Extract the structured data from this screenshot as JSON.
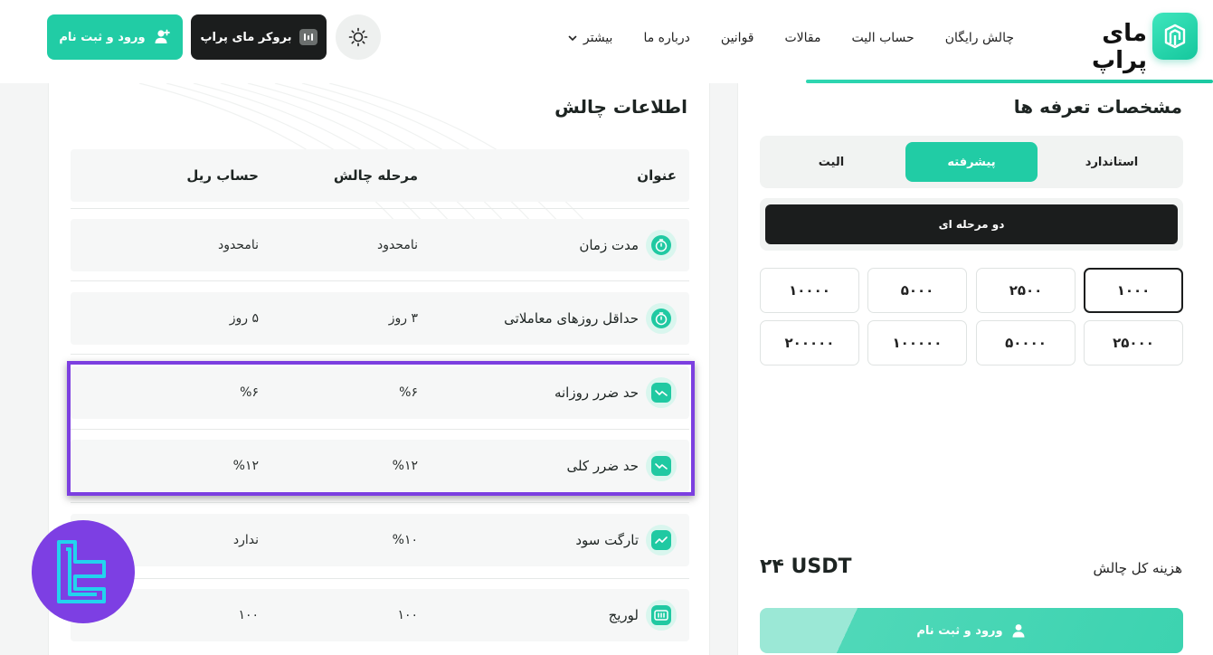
{
  "header": {
    "logo_text": "مای پراپ",
    "nav": [
      {
        "label": "چالش رایگان"
      },
      {
        "label": "حساب الیت"
      },
      {
        "label": "مقالات"
      },
      {
        "label": "قوانین"
      },
      {
        "label": "درباره ما"
      },
      {
        "label": "بیشتر",
        "icon": "chevron-down-icon"
      }
    ],
    "theme_icon": "sun-icon",
    "broker_label": "بروکر مای پراپ",
    "login_label": "ورود و ثبت نام",
    "accent_color": "#21cca5"
  },
  "challenge_info": {
    "title": "اطلاعات چالش",
    "headers": {
      "title": "عنوان",
      "stage": "مرحله چالش",
      "real": "حساب ریل"
    },
    "rows": [
      {
        "title": "مدت زمان",
        "icon": "timer-icon",
        "stage": "نامحدود",
        "real": "نامحدود"
      },
      {
        "title": "حداقل روزهای معاملاتی",
        "icon": "timer-icon",
        "stage": "۳ روز",
        "real": "۵ روز"
      },
      {
        "title": "حد ضرر روزانه",
        "icon": "chart-down-icon",
        "stage": "%۶",
        "real": "%۶"
      },
      {
        "title": "حد ضرر کلی",
        "icon": "chart-down-icon",
        "stage": "%۱۲",
        "real": "%۱۲"
      },
      {
        "title": "تارگت سود",
        "icon": "chart-up-icon",
        "stage": "%۱۰",
        "real": "ندارد"
      },
      {
        "title": "لوریج",
        "icon": "leverage-icon",
        "stage": "۱۰۰",
        "real": "۱۰۰"
      }
    ],
    "highlight_color": "#7c3fe0"
  },
  "plans": {
    "title": "مشخصات تعرفه ها",
    "tiers": [
      "استاندارد",
      "پیشرفته",
      "الیت"
    ],
    "active_tier": "پیشرفته",
    "phase": "دو مرحله ای",
    "amounts": [
      "۱۰۰۰",
      "۲۵۰۰",
      "۵۰۰۰",
      "۱۰۰۰۰",
      "۲۵۰۰۰",
      "۵۰۰۰۰",
      "۱۰۰۰۰۰",
      "۲۰۰۰۰۰"
    ],
    "active_amount": "۱۰۰۰",
    "cost_label": "هزینه کل چالش",
    "cost_value": "۲۴ USDT",
    "buy_label": "ورود و ثبت نام"
  }
}
